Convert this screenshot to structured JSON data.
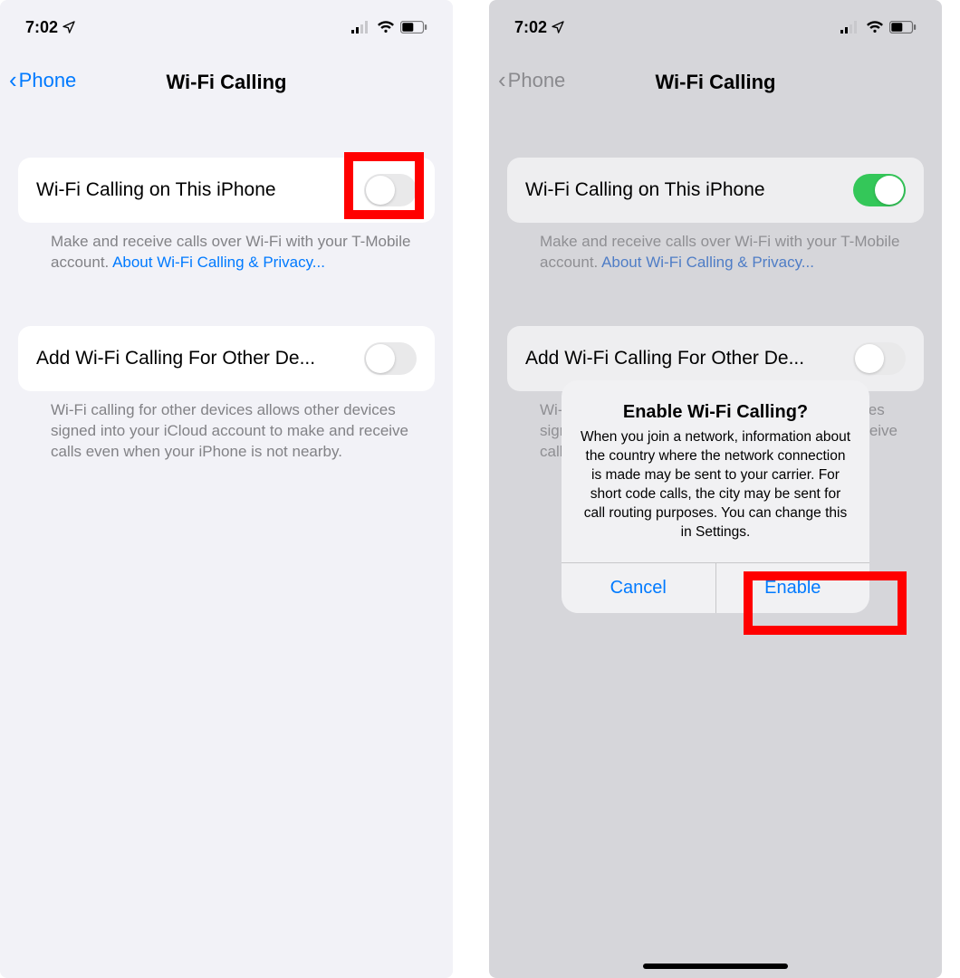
{
  "status": {
    "time": "7:02"
  },
  "left": {
    "back_label": "Phone",
    "title": "Wi-Fi Calling",
    "row1": {
      "label": "Wi-Fi Calling on This iPhone",
      "footer_pre": "Make and receive calls over Wi-Fi with your T-Mobile account. ",
      "footer_link": "About Wi-Fi Calling & Privacy..."
    },
    "row2": {
      "label": "Add Wi-Fi Calling For Other De...",
      "footer": "Wi-Fi calling for other devices allows other devices signed into your iCloud account to make and receive calls even when your iPhone is not nearby."
    }
  },
  "right": {
    "back_label": "Phone",
    "title": "Wi-Fi Calling",
    "row1": {
      "label": "Wi-Fi Calling on This iPhone",
      "footer_pre": "Make and receive calls over Wi-Fi with your T-Mobile account. ",
      "footer_link": "About Wi-Fi Calling & Privacy..."
    },
    "row2": {
      "label": "Add Wi-Fi Calling For Other De...",
      "footer": "Wi-Fi calling for other devices allows other devices signed into your iCloud account to make and receive calls even when your iPhone is not nearby."
    },
    "alert": {
      "title": "Enable Wi-Fi Calling?",
      "message": "When you join a network, information about the country where the network connection is made may be sent to your carrier. For short code calls, the city may be sent for call routing purposes. You can change this in Settings.",
      "cancel": "Cancel",
      "enable": "Enable"
    }
  }
}
